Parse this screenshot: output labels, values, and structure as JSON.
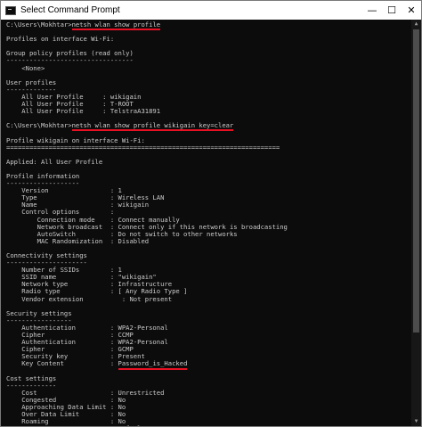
{
  "window": {
    "title": "Select Command Prompt",
    "minimize": "—",
    "maximize": "☐",
    "close": "✕"
  },
  "console": {
    "lines": [
      {
        "text": "C:\\Users\\Mokhtar>netsh wlan show profile",
        "underline_from": 17
      },
      {
        "text": ""
      },
      {
        "text": "Profiles on interface Wi-Fi:"
      },
      {
        "text": ""
      },
      {
        "text": "Group policy profiles (read only)"
      },
      {
        "text": "---------------------------------"
      },
      {
        "text": "    <None>"
      },
      {
        "text": ""
      },
      {
        "text": "User profiles"
      },
      {
        "text": "-------------"
      },
      {
        "text": "    All User Profile     : wikigain"
      },
      {
        "text": "    All User Profile     : T-ROOT"
      },
      {
        "text": "    All User Profile     : TelstraA31891"
      },
      {
        "text": ""
      },
      {
        "text": "C:\\Users\\Mokhtar>netsh wlan show profile wikigain key=clear",
        "underline_from": 17
      },
      {
        "text": ""
      },
      {
        "text": "Profile wikigain on interface Wi-Fi:"
      },
      {
        "text": "======================================================================="
      },
      {
        "text": ""
      },
      {
        "text": "Applied: All User Profile"
      },
      {
        "text": ""
      },
      {
        "text": "Profile information"
      },
      {
        "text": "-------------------"
      },
      {
        "text": "    Version                : 1"
      },
      {
        "text": "    Type                   : Wireless LAN"
      },
      {
        "text": "    Name                   : wikigain"
      },
      {
        "text": "    Control options        :"
      },
      {
        "text": "        Connection mode    : Connect manually"
      },
      {
        "text": "        Network broadcast  : Connect only if this network is broadcasting"
      },
      {
        "text": "        AutoSwitch         : Do not switch to other networks"
      },
      {
        "text": "        MAC Randomization  : Disabled"
      },
      {
        "text": ""
      },
      {
        "text": "Connectivity settings"
      },
      {
        "text": "---------------------"
      },
      {
        "text": "    Number of SSIDs        : 1"
      },
      {
        "text": "    SSID name              : \"wikigain\""
      },
      {
        "text": "    Network type           : Infrastructure"
      },
      {
        "text": "    Radio type             : [ Any Radio Type ]"
      },
      {
        "text": "    Vendor extension          : Not present"
      },
      {
        "text": ""
      },
      {
        "text": "Security settings"
      },
      {
        "text": "-----------------"
      },
      {
        "text": "    Authentication         : WPA2-Personal"
      },
      {
        "text": "    Cipher                 : CCMP"
      },
      {
        "text": "    Authentication         : WPA2-Personal"
      },
      {
        "text": "    Cipher                 : GCMP"
      },
      {
        "text": "    Security key           : Present"
      },
      {
        "text": "    Key Content            : Password_is_Hacked",
        "underline_from": 29
      },
      {
        "text": ""
      },
      {
        "text": "Cost settings"
      },
      {
        "text": "-------------"
      },
      {
        "text": "    Cost                   : Unrestricted"
      },
      {
        "text": "    Congested              : No"
      },
      {
        "text": "    Approaching Data Limit : No"
      },
      {
        "text": "    Over Data Limit        : No"
      },
      {
        "text": "    Roaming                : No"
      },
      {
        "text": "    Cost Source            : Default"
      }
    ]
  },
  "colors": {
    "console_bg": "#0c0c0c",
    "console_text": "#cccccc",
    "highlight_underline": "#e81123"
  }
}
